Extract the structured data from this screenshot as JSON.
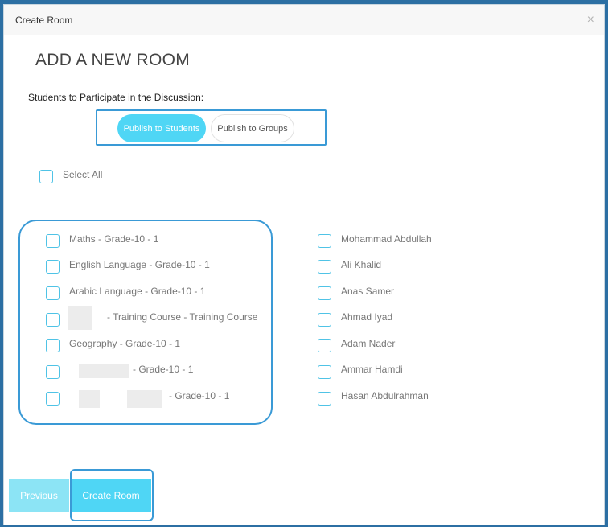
{
  "modal": {
    "title": "Create Room",
    "close_glyph": "×",
    "heading": "ADD A NEW ROOM",
    "section_label": "Students to Participate in the Discussion:"
  },
  "publish_toggle": {
    "students_label": "Publish to Students",
    "groups_label": "Publish to Groups",
    "selected": "students"
  },
  "select_all": {
    "label": "Select All",
    "checked": false
  },
  "groups": [
    {
      "label": "Maths - Grade-10 - 1",
      "checked": false
    },
    {
      "label": "English Language - Grade-10 - 1",
      "checked": false
    },
    {
      "label": "Arabic Language - Grade-10 - 1",
      "checked": false
    },
    {
      "label": "- Training Course - Training Course",
      "checked": false,
      "redacted_prefix": true
    },
    {
      "label": "Geography - Grade-10 - 1",
      "checked": false
    },
    {
      "label": "- Grade-10 - 1",
      "checked": false,
      "redacted_prefix": true
    },
    {
      "label": "- Grade-10 - 1",
      "checked": false,
      "redacted_prefix": true
    }
  ],
  "students": [
    {
      "name": "Mohammad Abdullah",
      "checked": false
    },
    {
      "name": "Ali Khalid",
      "checked": false
    },
    {
      "name": "Anas Samer",
      "checked": false
    },
    {
      "name": "Ahmad Iyad",
      "checked": false
    },
    {
      "name": "Adam Nader",
      "checked": false
    },
    {
      "name": "Ammar Hamdi",
      "checked": false
    },
    {
      "name": "Hasan Abdulrahman",
      "checked": false
    }
  ],
  "footer": {
    "previous_label": "Previous",
    "create_label": "Create Room"
  },
  "colors": {
    "accent": "#4fd6f5",
    "accent_light": "#8ce4f5",
    "highlight_frame": "#3a9ad6"
  }
}
